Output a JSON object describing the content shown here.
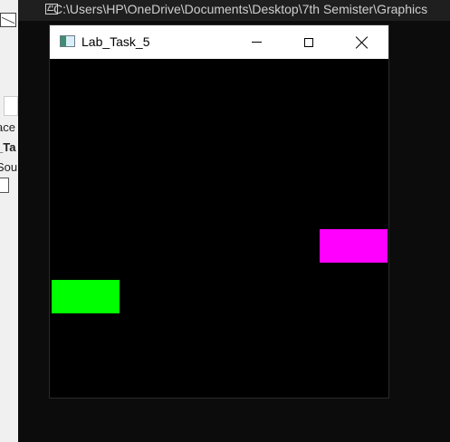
{
  "console": {
    "title": "\"C:\\Users\\HP\\OneDrive\\Documents\\Desktop\\7th Semister\\Graphics"
  },
  "ide": {
    "lines": [
      "ace",
      "_Ta",
      "Sou"
    ]
  },
  "app": {
    "title": "Lab_Task_5",
    "shapes": [
      {
        "name": "green-rectangle",
        "color": "#00ff00"
      },
      {
        "name": "magenta-rectangle",
        "color": "#ff00ff"
      }
    ]
  }
}
